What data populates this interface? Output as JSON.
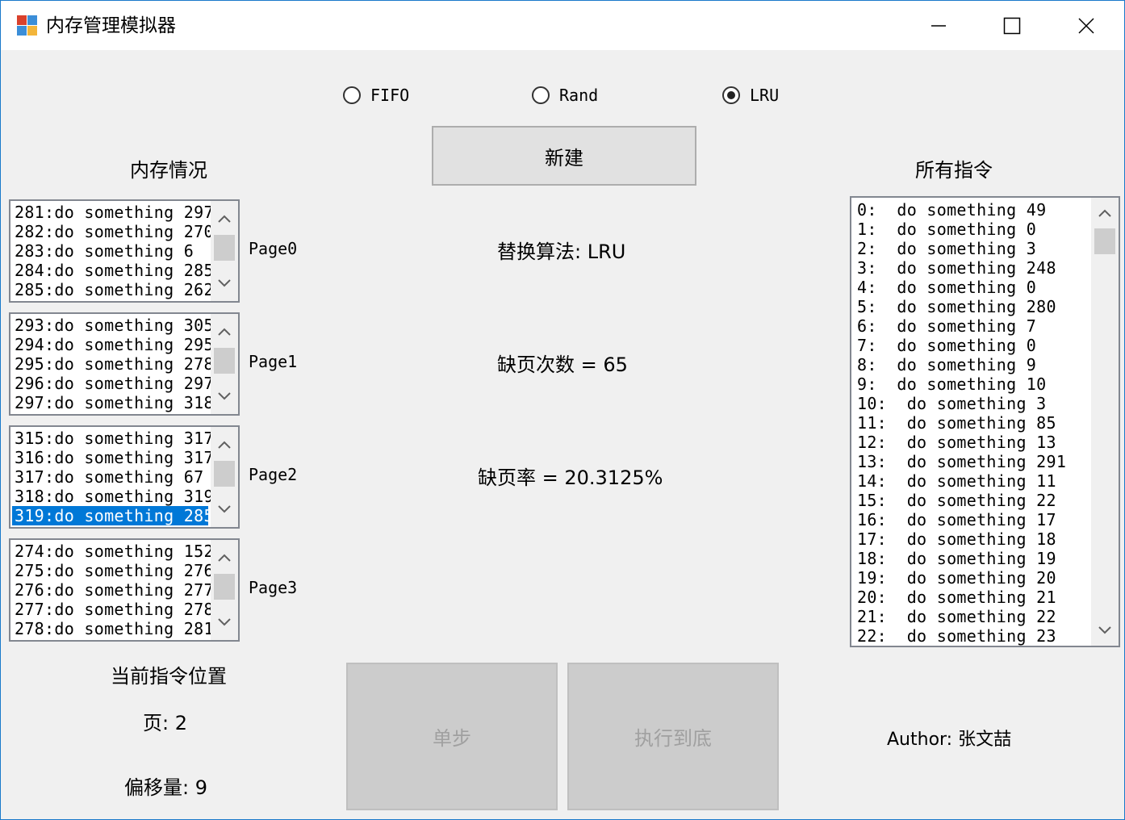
{
  "window": {
    "title": "内存管理模拟器"
  },
  "algorithms": [
    {
      "label": "FIFO",
      "checked": false
    },
    {
      "label": "Rand",
      "checked": false
    },
    {
      "label": "LRU",
      "checked": true
    }
  ],
  "new_button": "新建",
  "memory_title": "内存情况",
  "all_instructions_title": "所有指令",
  "frames": [
    {
      "label": "Page0",
      "rows": [
        "281:do something 297",
        "282:do something 270",
        "283:do something 6",
        "284:do something 285",
        "285:do something 262"
      ],
      "selected": -1
    },
    {
      "label": "Page1",
      "rows": [
        "293:do something 305",
        "294:do something 295",
        "295:do something 278",
        "296:do something 297",
        "297:do something 318"
      ],
      "selected": -1
    },
    {
      "label": "Page2",
      "rows": [
        "315:do something 317",
        "316:do something 317",
        "317:do something 67",
        "318:do something 319",
        "319:do something 285"
      ],
      "selected": 4
    },
    {
      "label": "Page3",
      "rows": [
        "274:do something 152",
        "275:do something 276",
        "276:do something 277",
        "277:do something 278",
        "278:do something 281"
      ],
      "selected": -1
    }
  ],
  "stats": {
    "algorithm_line": "替换算法: LRU",
    "fault_count_line": "缺页次数 = 65",
    "fault_rate_line": "缺页率 = 20.3125%"
  },
  "current_position": {
    "title": "当前指令位置",
    "page_line": "页: 2",
    "offset_line": "偏移量: 9"
  },
  "step_button": "单步",
  "run_button": "执行到底",
  "author_line": "Author: 张文喆",
  "instructions": [
    "0:  do something 49",
    "1:  do something 0",
    "2:  do something 3",
    "3:  do something 248",
    "4:  do something 0",
    "5:  do something 280",
    "6:  do something 7",
    "7:  do something 0",
    "8:  do something 9",
    "9:  do something 10",
    "10:  do something 3",
    "11:  do something 85",
    "12:  do something 13",
    "13:  do something 291",
    "14:  do something 11",
    "15:  do something 22",
    "16:  do something 17",
    "17:  do something 18",
    "18:  do something 19",
    "19:  do something 20",
    "20:  do something 21",
    "21:  do something 22",
    "22:  do something 23"
  ],
  "icons": {
    "app": "app-icon",
    "minimize": "minimize-icon",
    "maximize": "maximize-icon",
    "close": "close-icon",
    "scroll_up": "chevron-up-icon",
    "scroll_down": "chevron-down-icon"
  },
  "colors": {
    "selection": "#0078d7",
    "window_border": "#1979ca"
  }
}
